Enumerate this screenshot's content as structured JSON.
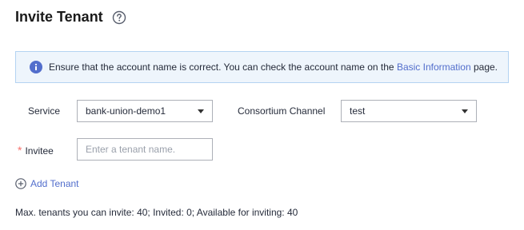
{
  "header": {
    "title": "Invite Tenant",
    "help_icon": "question-circle-icon"
  },
  "notice": {
    "icon": "info-icon",
    "text_before": "Ensure that the account name is correct. You can check the account name on the ",
    "link_text": "Basic Information",
    "text_after": " page."
  },
  "form": {
    "service": {
      "label": "Service",
      "value": "bank-union-demo1"
    },
    "channel": {
      "label": "Consortium Channel",
      "value": "test"
    },
    "invitee": {
      "required_mark": "*",
      "label": "Invitee",
      "placeholder": "Enter a tenant name.",
      "value": ""
    }
  },
  "actions": {
    "add_tenant_label": "Add Tenant",
    "add_tenant_icon": "plus-circle-icon"
  },
  "summary": {
    "text": "Max. tenants you can invite: 40; Invited: 0; Available for inviting: 40"
  },
  "colors": {
    "link": "#526ecc",
    "info": "#526ecc",
    "required": "#f66f6a",
    "notice_bg": "#eef5fc",
    "notice_border": "#b4d3f2"
  }
}
